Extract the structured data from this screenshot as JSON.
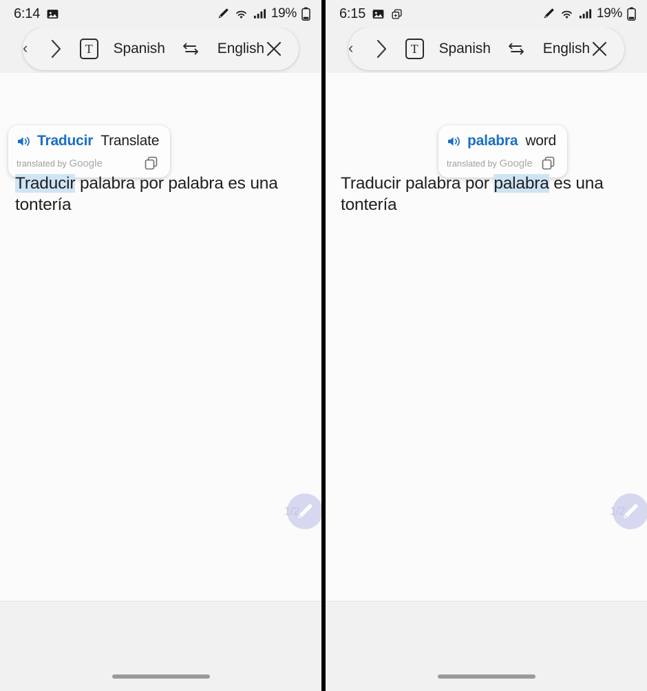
{
  "panels": [
    {
      "status": {
        "time": "6:14",
        "battery_percent": "19%",
        "icons": [
          "image-icon",
          "stylus-icon",
          "wifi-icon",
          "signal-icon",
          "battery-icon"
        ]
      },
      "toolbar": {
        "back_chevron": "‹",
        "forward_chevron": "›",
        "text_mode_label": "T",
        "source_language": "Spanish",
        "target_language": "English",
        "swap_label": "swap-languages",
        "close_label": "×"
      },
      "card": {
        "source_word": "Traducir",
        "target_word": "Translate",
        "attribution_prefix": "translated by",
        "attribution_brand": "Google",
        "speaker_label": "listen",
        "copy_label": "copy"
      },
      "body": {
        "before": "",
        "highlight": "Traducir",
        "after": " palabra por palabra es una tontería"
      },
      "fab": {
        "label": "1/2",
        "icon": "pen-icon"
      }
    },
    {
      "status": {
        "time": "6:15",
        "battery_percent": "19%",
        "icons": [
          "image-icon",
          "screenshot-icon",
          "stylus-icon",
          "wifi-icon",
          "signal-icon",
          "battery-icon"
        ]
      },
      "toolbar": {
        "back_chevron": "‹",
        "forward_chevron": "›",
        "text_mode_label": "T",
        "source_language": "Spanish",
        "target_language": "English",
        "swap_label": "swap-languages",
        "close_label": "×"
      },
      "card": {
        "source_word": "palabra",
        "target_word": "word",
        "attribution_prefix": "translated by",
        "attribution_brand": "Google",
        "speaker_label": "listen",
        "copy_label": "copy"
      },
      "body": {
        "before": "Traducir palabra por ",
        "highlight": "palabra",
        "after": " es una tontería"
      },
      "fab": {
        "label": "1/2",
        "icon": "pen-icon"
      }
    }
  ],
  "colors": {
    "accent_blue": "#1a6fc4",
    "highlight_blue": "#cfe5f5",
    "status_bg": "#f1f1f1",
    "content_bg": "#fbfbfb",
    "fab_purple": "#b9bce8"
  }
}
